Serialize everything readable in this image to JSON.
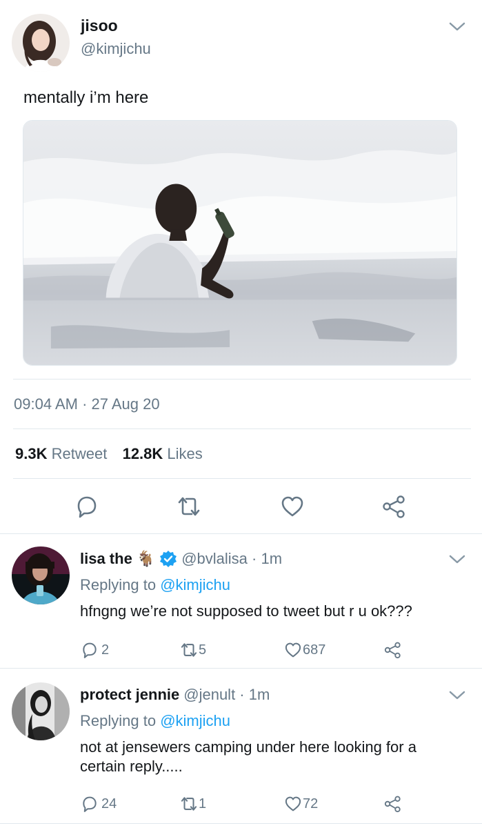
{
  "tweet": {
    "display_name": "jisoo",
    "handle": "@kimjichu",
    "text": "mentally i’m here",
    "timestamp": "09:04 AM · 27 Aug 20",
    "retweets_count": "9.3K",
    "retweets_label": "Retweet",
    "likes_count": "12.8K",
    "likes_label": "Likes"
  },
  "replies": [
    {
      "display_name": "lisa the",
      "emoji": "🐐",
      "verified": true,
      "handle": "@bvlalisa · 1m",
      "replying_prefix": "Replying to",
      "replying_to": "@kimjichu",
      "text": "hfngng we’re not supposed to tweet but r u ok???",
      "reply_count": "2",
      "retweet_count": "5",
      "like_count": "687"
    },
    {
      "display_name": "protect jennie",
      "handle": "@jenult · 1m",
      "replying_prefix": "Replying to",
      "replying_to": "@kimjichu",
      "text": "not at jensewers camping under here looking for a certain reply.....",
      "reply_count": "24",
      "retweet_count": "1",
      "like_count": "72"
    }
  ],
  "colors": {
    "accent": "#1da1f2",
    "muted": "#657786",
    "text": "#14171a",
    "divider": "#e1e8ed"
  },
  "icons": {
    "reply": "reply-icon",
    "retweet": "retweet-icon",
    "like": "heart-icon",
    "share": "share-icon",
    "more": "chevron-down-icon",
    "verified": "verified-badge-icon"
  }
}
